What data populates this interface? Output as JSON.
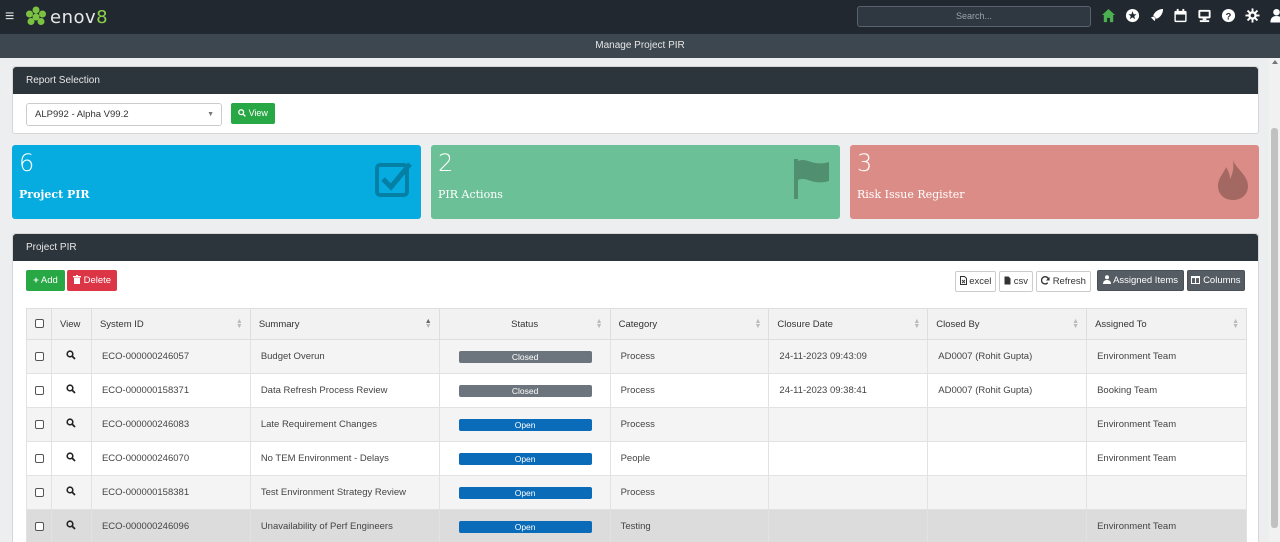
{
  "app": {
    "logo_prefix": "enov",
    "logo_digit": "8",
    "search_placeholder": "Search...",
    "page_title": "Manage Project PIR"
  },
  "report_selection": {
    "title": "Report Selection",
    "selected_release": "ALP992 - Alpha V99.2",
    "view_label": "View"
  },
  "cards": [
    {
      "count": "6",
      "label": "Project PIR",
      "color": "#06ace0",
      "icon": "checkbox-icon"
    },
    {
      "count": "2",
      "label": "PIR Actions",
      "color": "#6cc097",
      "icon": "flag-icon"
    },
    {
      "count": "3",
      "label": "Risk Issue Register",
      "color": "#dc8c86",
      "icon": "fire-icon"
    }
  ],
  "pir": {
    "title": "Project PIR",
    "add_label": "Add",
    "delete_label": "Delete",
    "excel_label": "excel",
    "csv_label": "csv",
    "refresh_label": "Refresh",
    "assigned_label": "Assigned Items",
    "columns_label": "Columns",
    "columns": [
      "View",
      "System ID",
      "Summary",
      "Status",
      "Category",
      "Closure Date",
      "Closed By",
      "Assigned To"
    ],
    "rows": [
      {
        "id": "ECO-000000246057",
        "summary": "Budget Overun",
        "status": "Closed",
        "category": "Process",
        "closure_date": "24-11-2023 09:43:09",
        "closed_by": "AD0007 (Rohit Gupta)",
        "assigned_to": "Environment Team"
      },
      {
        "id": "ECO-000000158371",
        "summary": "Data Refresh Process Review",
        "status": "Closed",
        "category": "Process",
        "closure_date": "24-11-2023 09:38:41",
        "closed_by": "AD0007 (Rohit Gupta)",
        "assigned_to": "Booking Team"
      },
      {
        "id": "ECO-000000246083",
        "summary": "Late Requirement Changes",
        "status": "Open",
        "category": "Process",
        "closure_date": "",
        "closed_by": "",
        "assigned_to": "Environment Team"
      },
      {
        "id": "ECO-000000246070",
        "summary": "No TEM Environment - Delays",
        "status": "Open",
        "category": "People",
        "closure_date": "",
        "closed_by": "",
        "assigned_to": "Environment Team"
      },
      {
        "id": "ECO-000000158381",
        "summary": "Test Environment Strategy Review",
        "status": "Open",
        "category": "Process",
        "closure_date": "",
        "closed_by": "",
        "assigned_to": ""
      },
      {
        "id": "ECO-000000246096",
        "summary": "Unavailability of Perf Engineers",
        "status": "Open",
        "category": "Testing",
        "closure_date": "",
        "closed_by": "",
        "assigned_to": "Environment Team"
      }
    ]
  },
  "colors": {
    "topbar": "#212830",
    "closed": "#6c757d",
    "open": "#0a6bb8",
    "green": "#28a745",
    "red": "#dc3545"
  }
}
